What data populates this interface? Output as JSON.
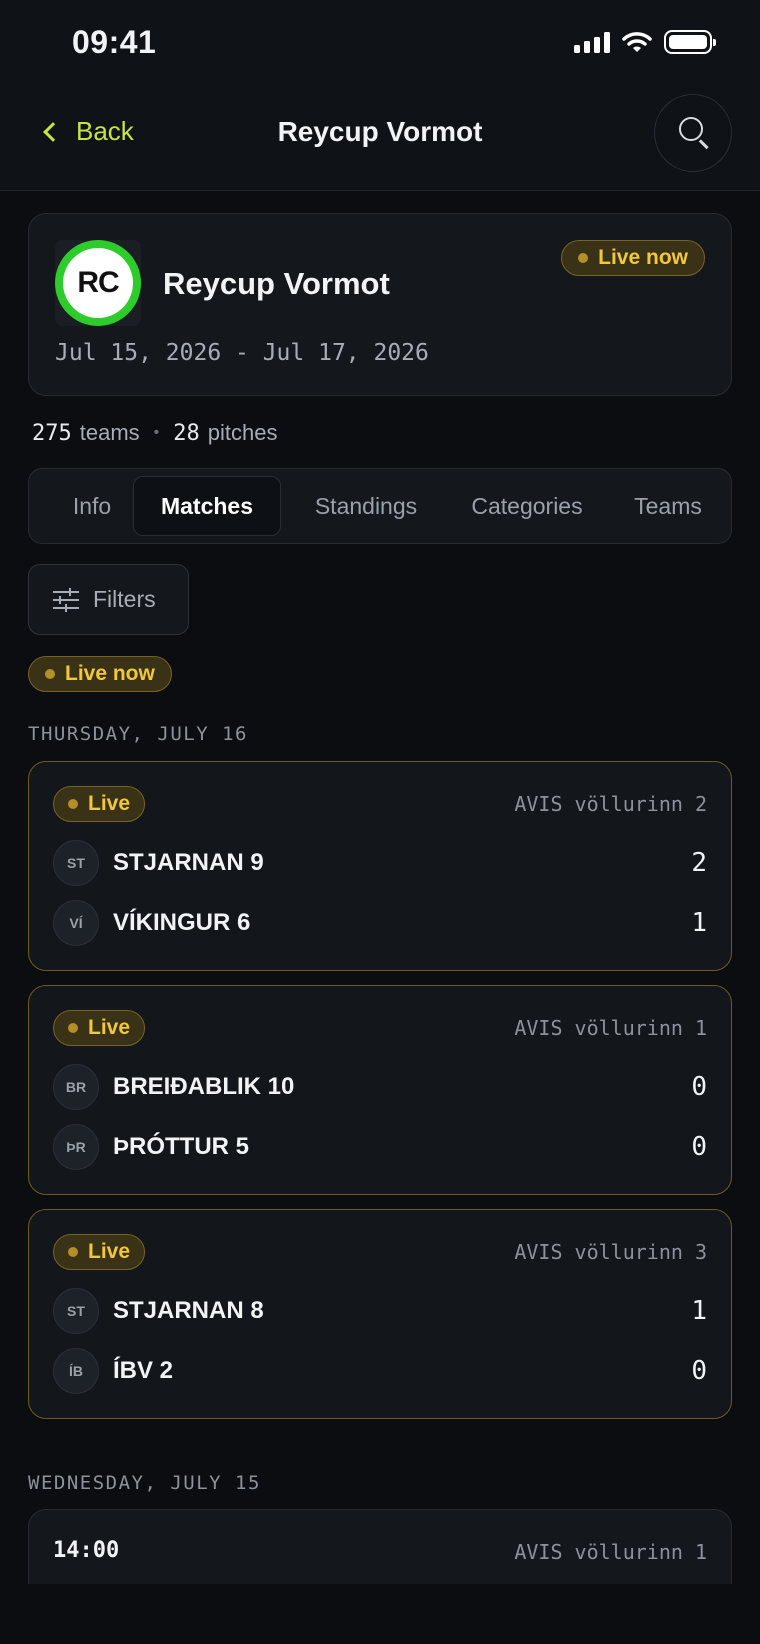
{
  "status_bar": {
    "time": "09:41"
  },
  "header": {
    "back_label": "Back",
    "title": "Reycup Vormot"
  },
  "tournament": {
    "logo_text": "RC",
    "name": "Reycup Vormot",
    "dates": "Jul 15, 2026 - Jul 17, 2026",
    "live_label": "Live now"
  },
  "stats": {
    "teams_count": "275",
    "teams_label": "teams",
    "separator": "•",
    "pitches_count": "28",
    "pitches_label": "pitches"
  },
  "tabs": [
    {
      "label": "Info"
    },
    {
      "label": "Matches"
    },
    {
      "label": "Standings"
    },
    {
      "label": "Categories"
    },
    {
      "label": "Teams"
    }
  ],
  "filters": {
    "label": "Filters"
  },
  "live_chip": "Live now",
  "sections": [
    {
      "label": "THURSDAY, JULY 16"
    },
    {
      "label": "WEDNESDAY, JULY 15"
    }
  ],
  "matches": [
    {
      "status": "Live",
      "pitch": "AVIS völlurinn 2",
      "home": {
        "initials": "ST",
        "name": "STJARNAN 9",
        "score": "2"
      },
      "away": {
        "initials": "VÍ",
        "name": "VÍKINGUR 6",
        "score": "1"
      }
    },
    {
      "status": "Live",
      "pitch": "AVIS völlurinn 1",
      "home": {
        "initials": "BR",
        "name": "BREIÐABLIK 10",
        "score": "0"
      },
      "away": {
        "initials": "ÞR",
        "name": "ÞRÓTTUR 5",
        "score": "0"
      }
    },
    {
      "status": "Live",
      "pitch": "AVIS völlurinn 3",
      "home": {
        "initials": "ST",
        "name": "STJARNAN 8",
        "score": "1"
      },
      "away": {
        "initials": "ÍB",
        "name": "ÍBV 2",
        "score": "0"
      }
    }
  ],
  "upcoming": {
    "time": "14:00",
    "pitch": "AVIS völlurinn 1"
  },
  "colors": {
    "accent": "#c6e63a",
    "live": "#f1c83b",
    "logo_ring": "#2ecc2a"
  }
}
